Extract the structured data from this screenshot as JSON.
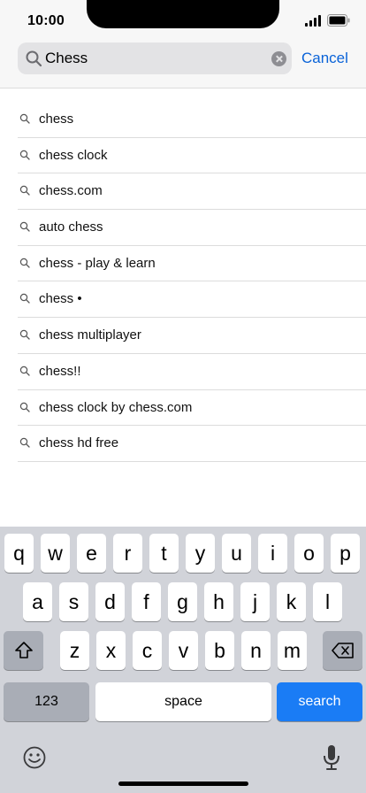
{
  "status_bar": {
    "time": "10:00"
  },
  "search": {
    "value": "Chess",
    "cancel_label": "Cancel"
  },
  "suggestions": [
    "chess",
    "chess clock",
    "chess.com",
    "auto chess",
    "chess - play & learn",
    "chess •",
    "chess multiplayer",
    "chess!!",
    "chess clock by chess.com",
    "chess hd free"
  ],
  "keyboard": {
    "row1": [
      "q",
      "w",
      "e",
      "r",
      "t",
      "y",
      "u",
      "i",
      "o",
      "p"
    ],
    "row2": [
      "a",
      "s",
      "d",
      "f",
      "g",
      "h",
      "j",
      "k",
      "l"
    ],
    "row3": [
      "z",
      "x",
      "c",
      "v",
      "b",
      "n",
      "m"
    ],
    "numbers_label": "123",
    "space_label": "space",
    "search_label": "search"
  },
  "colors": {
    "accent": "#0a63d8",
    "search_key": "#1a7cf5",
    "keyboard_bg": "#d1d3d9"
  },
  "icons": [
    "search-icon",
    "clear-icon",
    "shift-icon",
    "backspace-icon",
    "emoji-icon",
    "microphone-icon"
  ]
}
